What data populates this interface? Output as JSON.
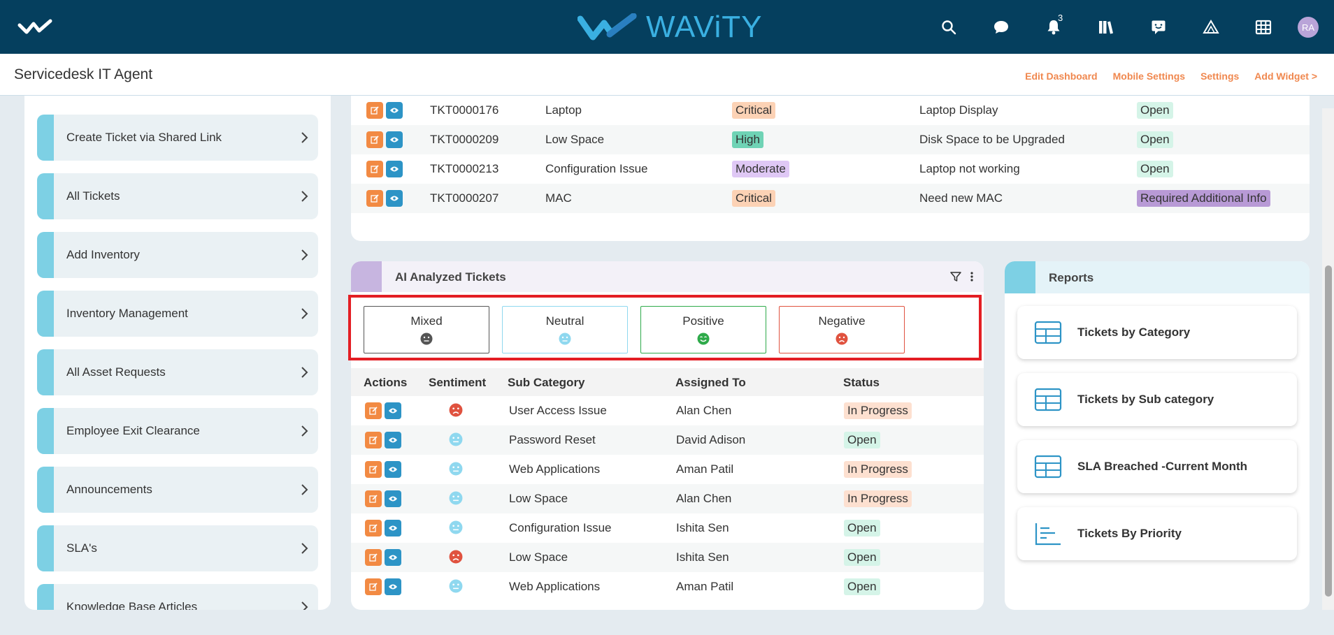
{
  "header": {
    "brand_name": "WAViTY",
    "notifications_count": "3",
    "avatar_initials": "RA"
  },
  "subheader": {
    "title": "Servicedesk IT Agent",
    "links": [
      "Edit Dashboard",
      "Mobile Settings",
      "Settings",
      "Add Widget >"
    ]
  },
  "sidebar": {
    "items": [
      {
        "label": "Create Ticket via Shared Link"
      },
      {
        "label": "All Tickets"
      },
      {
        "label": "Add Inventory"
      },
      {
        "label": "Inventory Management"
      },
      {
        "label": "All Asset Requests"
      },
      {
        "label": "Employee Exit Clearance"
      },
      {
        "label": "Announcements"
      },
      {
        "label": "SLA's"
      },
      {
        "label": "Knowledge Base Articles"
      }
    ]
  },
  "top_table": {
    "rows": [
      {
        "id": "TKT0000176",
        "category": "Laptop",
        "priority": "Critical",
        "subject": "Laptop Display",
        "status": "Open"
      },
      {
        "id": "TKT0000209",
        "category": "Low Space",
        "priority": "High",
        "subject": "Disk Space to be Upgraded",
        "status": "Open"
      },
      {
        "id": "TKT0000213",
        "category": "Configuration Issue",
        "priority": "Moderate",
        "subject": "Laptop not working",
        "status": "Open"
      },
      {
        "id": "TKT0000207",
        "category": "MAC",
        "priority": "Critical",
        "subject": "Need new MAC",
        "status": "Required Additional Info"
      }
    ]
  },
  "ai_panel": {
    "title": "AI Analyzed Tickets",
    "sentiments": [
      {
        "label": "Mixed",
        "color": "#555555"
      },
      {
        "label": "Neutral",
        "color": "#8fd8ef"
      },
      {
        "label": "Positive",
        "color": "#2eaa4a"
      },
      {
        "label": "Negative",
        "color": "#e0523f"
      }
    ],
    "columns": [
      "Actions",
      "Sentiment",
      "Sub Category",
      "Assigned To",
      "Status"
    ],
    "rows": [
      {
        "sentiment": "negative",
        "sub_category": "User Access Issue",
        "assigned_to": "Alan Chen",
        "status": "In Progress"
      },
      {
        "sentiment": "neutral",
        "sub_category": "Password Reset",
        "assigned_to": "David Adison",
        "status": "Open"
      },
      {
        "sentiment": "neutral",
        "sub_category": "Web Applications",
        "assigned_to": "Aman Patil",
        "status": "In Progress"
      },
      {
        "sentiment": "neutral",
        "sub_category": "Low Space",
        "assigned_to": "Alan Chen",
        "status": "In Progress"
      },
      {
        "sentiment": "neutral",
        "sub_category": "Configuration Issue",
        "assigned_to": "Ishita Sen",
        "status": "Open"
      },
      {
        "sentiment": "negative",
        "sub_category": "Low Space",
        "assigned_to": "Ishita Sen",
        "status": "Open"
      },
      {
        "sentiment": "neutral",
        "sub_category": "Web Applications",
        "assigned_to": "Aman Patil",
        "status": "Open"
      }
    ]
  },
  "reports": {
    "title": "Reports",
    "items": [
      {
        "label": "Tickets by Category",
        "icon": "table-icon"
      },
      {
        "label": "Tickets by Sub category",
        "icon": "table-icon"
      },
      {
        "label": "SLA Breached -Current Month",
        "icon": "table-icon"
      },
      {
        "label": "Tickets By Priority",
        "icon": "bar-chart-icon"
      }
    ]
  },
  "colors": {
    "topbar": "#053f5e",
    "accent_orange": "#f0884f",
    "accent_blue": "#2d94c6",
    "highlight": "#e31e24"
  }
}
